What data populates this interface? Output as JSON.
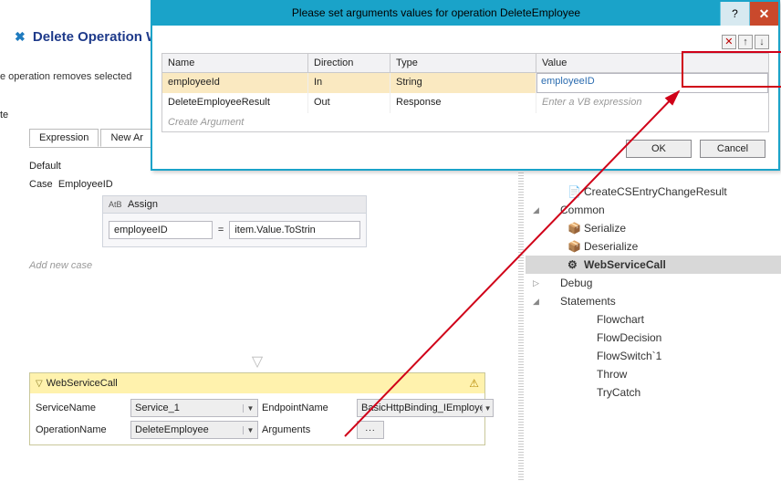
{
  "wizard": {
    "title": "Delete Operation Wo",
    "desc": "e operation removes selected",
    "side_item": "te"
  },
  "tabs": {
    "expression": "Expression",
    "newarg": "New Ar"
  },
  "switch": {
    "default_label": "Default",
    "case_prefix": "Case",
    "case_value": "EmployeeID",
    "assign_label": "Assign",
    "assign_to": "employeeID",
    "assign_eq": "=",
    "assign_value": "item.Value.ToStrin",
    "add_case": "Add new case"
  },
  "wsc": {
    "title": "WebServiceCall",
    "labels": {
      "service": "ServiceName",
      "endpoint": "EndpointName",
      "operation": "OperationName",
      "arguments": "Arguments"
    },
    "values": {
      "service": "Service_1",
      "endpoint": "BasicHttpBinding_IEmployeeService",
      "operation": "DeleteEmployee",
      "args_btn": "..."
    }
  },
  "dialog": {
    "title": "Please set arguments values for operation DeleteEmployee",
    "help": "?",
    "close": "✕",
    "tools": {
      "del": "✕",
      "up": "↑",
      "down": "↓"
    },
    "headers": {
      "name": "Name",
      "direction": "Direction",
      "type": "Type",
      "value": "Value"
    },
    "rows": [
      {
        "name": "employeeId",
        "direction": "In",
        "type": "String",
        "value": "employeeID"
      },
      {
        "name": "DeleteEmployeeResult",
        "direction": "Out",
        "type": "Response",
        "placeholder": "Enter a VB expression"
      }
    ],
    "create_arg": "Create Argument",
    "ok": "OK",
    "cancel": "Cancel"
  },
  "toolbox": {
    "items": [
      {
        "level": 2,
        "icon": "📄",
        "label": "CreateCSEntryChangeResult",
        "interact": true
      },
      {
        "level": 1,
        "exp": "◢",
        "label": "Common",
        "interact": true
      },
      {
        "level": 2,
        "icon": "📦",
        "label": "Serialize",
        "interact": true
      },
      {
        "level": 2,
        "icon": "📦",
        "label": "Deserialize",
        "interact": true
      },
      {
        "level": 2,
        "icon": "⚙",
        "label": "WebServiceCall",
        "interact": true,
        "selected": true
      },
      {
        "level": 1,
        "exp": "▷",
        "label": "Debug",
        "interact": true
      },
      {
        "level": 1,
        "exp": "◢",
        "label": "Statements",
        "interact": true
      },
      {
        "level": 3,
        "label": "Flowchart",
        "interact": true
      },
      {
        "level": 3,
        "label": "FlowDecision",
        "interact": true
      },
      {
        "level": 3,
        "label": "FlowSwitch`1",
        "interact": true
      },
      {
        "level": 3,
        "label": "Throw",
        "interact": true
      },
      {
        "level": 3,
        "label": "TryCatch",
        "interact": true
      }
    ]
  }
}
